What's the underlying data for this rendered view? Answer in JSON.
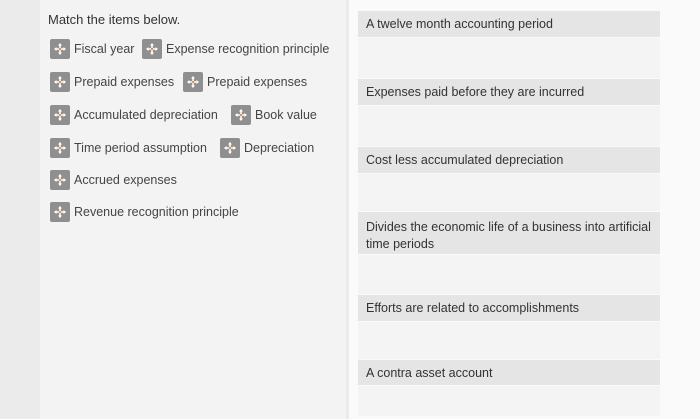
{
  "instructions": "Match the items below.",
  "drag_items": [
    {
      "label": "Fiscal year"
    },
    {
      "label": "Expense recognition principle"
    },
    {
      "label": "Prepaid expenses"
    },
    {
      "label": "Prepaid expenses"
    },
    {
      "label": "Accumulated depreciation"
    },
    {
      "label": "Book value"
    },
    {
      "label": "Time period assumption"
    },
    {
      "label": "Depreciation"
    },
    {
      "label": "Accrued expenses"
    },
    {
      "label": "Revenue recognition principle"
    }
  ],
  "targets": [
    {
      "label": "A twelve month accounting period"
    },
    {
      "label": "Expenses paid before they are incurred"
    },
    {
      "label": "Cost less accumulated depreciation"
    },
    {
      "label": "Divides the economic life of a business into artificial time periods"
    },
    {
      "label": "Efforts are related to accomplishments"
    },
    {
      "label": "A contra asset account"
    }
  ],
  "icons": {
    "drag_handle": "move-arrows-icon"
  },
  "colors": {
    "handle_bg": "#8f8f8f",
    "target_bg": "#e5e5e5",
    "page_bg": "#ebebeb"
  }
}
